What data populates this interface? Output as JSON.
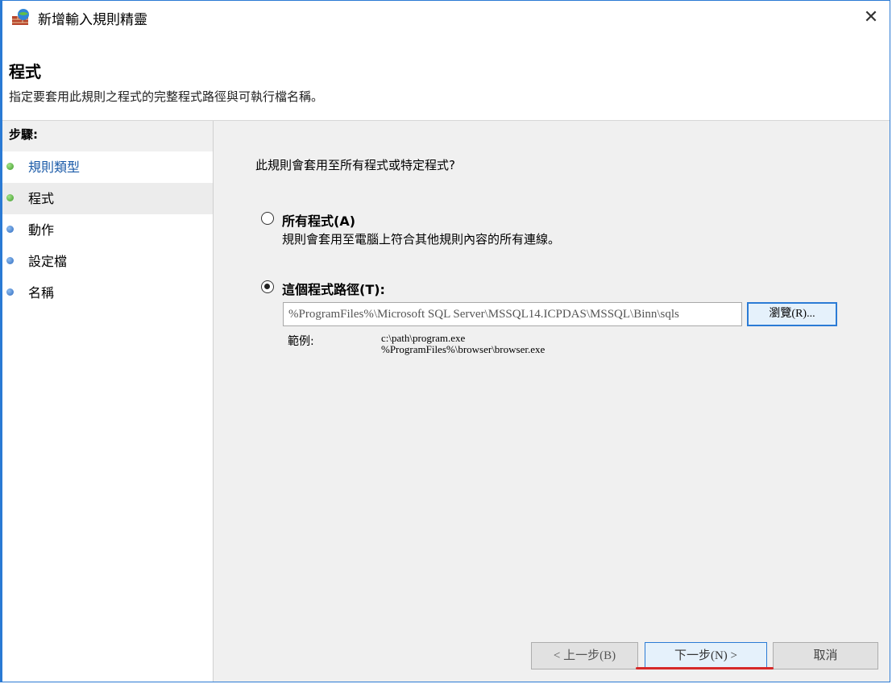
{
  "window": {
    "title": "新增輸入規則精靈",
    "app_icon": "firewall-icon",
    "close_glyph": "✕",
    "accent_color": "#2a7ad4"
  },
  "header": {
    "title": "程式",
    "description": "指定要套用此規則之程式的完整程式路徑與可執行檔名稱。"
  },
  "steps": {
    "heading": "步驟:",
    "items": [
      {
        "label": "規則類型",
        "state": "done"
      },
      {
        "label": "程式",
        "state": "current"
      },
      {
        "label": "動作",
        "state": "pending"
      },
      {
        "label": "設定檔",
        "state": "pending"
      },
      {
        "label": "名稱",
        "state": "pending"
      }
    ]
  },
  "main": {
    "question": "此規則會套用至所有程式或特定程式?",
    "option_all": {
      "label": "所有程式(A)",
      "description": "規則會套用至電腦上符合其他規則內容的所有連線。",
      "checked": false
    },
    "option_path": {
      "label": "這個程式路徑(T):",
      "checked": true,
      "value": "%ProgramFiles%\\Microsoft SQL Server\\MSSQL14.ICPDAS\\MSSQL\\Binn\\sqls",
      "browse_label": "瀏覽(R)..."
    },
    "example": {
      "label": "範例:",
      "line1": "c:\\path\\program.exe",
      "line2": "%ProgramFiles%\\browser\\browser.exe"
    }
  },
  "footer": {
    "back_label": "< 上一步(B)",
    "next_label": "下一步(N) >",
    "cancel_label": "取消",
    "highlight_color": "#d62a2a"
  }
}
